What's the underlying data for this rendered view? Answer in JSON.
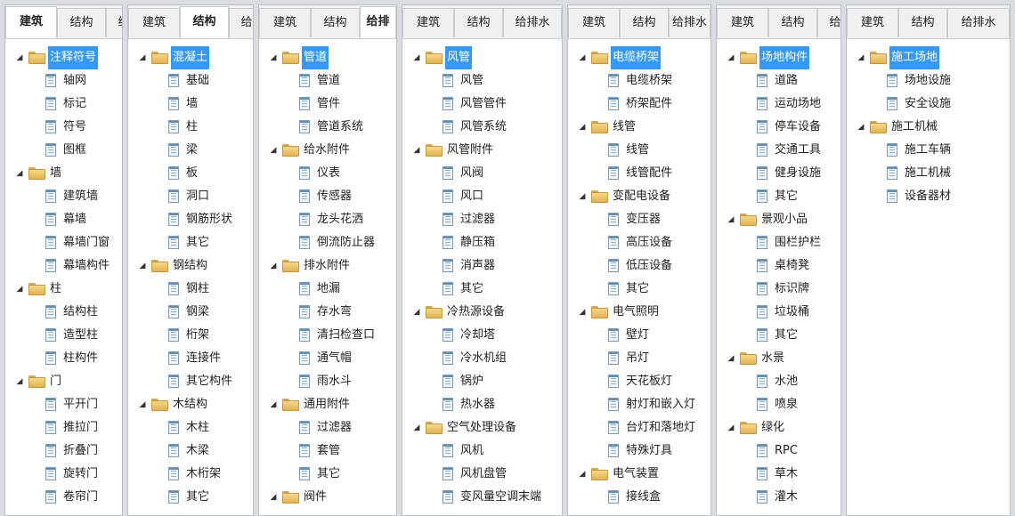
{
  "colors": {
    "selection": "#3399ff",
    "folder": "#e8b95a",
    "background": "#d9dde2"
  },
  "panels": [
    {
      "tabs": [
        "建筑",
        "结构",
        "给"
      ],
      "active_tab": 0,
      "rows": [
        {
          "level": 0,
          "type": "folder",
          "label": "注释符号",
          "selected": true
        },
        {
          "level": 1,
          "type": "doc",
          "label": "轴网"
        },
        {
          "level": 1,
          "type": "doc",
          "label": "标记"
        },
        {
          "level": 1,
          "type": "doc",
          "label": "符号"
        },
        {
          "level": 1,
          "type": "doc",
          "label": "图框"
        },
        {
          "level": 0,
          "type": "folder",
          "label": "墙"
        },
        {
          "level": 1,
          "type": "doc",
          "label": "建筑墙"
        },
        {
          "level": 1,
          "type": "doc",
          "label": "幕墙"
        },
        {
          "level": 1,
          "type": "doc",
          "label": "幕墙门窗"
        },
        {
          "level": 1,
          "type": "doc",
          "label": "幕墙构件"
        },
        {
          "level": 0,
          "type": "folder",
          "label": "柱"
        },
        {
          "level": 1,
          "type": "doc",
          "label": "结构柱"
        },
        {
          "level": 1,
          "type": "doc",
          "label": "造型柱"
        },
        {
          "level": 1,
          "type": "doc",
          "label": "柱构件"
        },
        {
          "level": 0,
          "type": "folder",
          "label": "门"
        },
        {
          "level": 1,
          "type": "doc",
          "label": "平开门"
        },
        {
          "level": 1,
          "type": "doc",
          "label": "推拉门"
        },
        {
          "level": 1,
          "type": "doc",
          "label": "折叠门"
        },
        {
          "level": 1,
          "type": "doc",
          "label": "旋转门"
        },
        {
          "level": 1,
          "type": "doc",
          "label": "卷帘门"
        }
      ]
    },
    {
      "tabs": [
        "建筑",
        "结构",
        "给"
      ],
      "active_tab": 1,
      "rows": [
        {
          "level": 0,
          "type": "folder",
          "label": "混凝土",
          "selected": true
        },
        {
          "level": 1,
          "type": "doc",
          "label": "基础"
        },
        {
          "level": 1,
          "type": "doc",
          "label": "墙"
        },
        {
          "level": 1,
          "type": "doc",
          "label": "柱"
        },
        {
          "level": 1,
          "type": "doc",
          "label": "梁"
        },
        {
          "level": 1,
          "type": "doc",
          "label": "板"
        },
        {
          "level": 1,
          "type": "doc",
          "label": "洞口"
        },
        {
          "level": 1,
          "type": "doc",
          "label": "钢筋形状"
        },
        {
          "level": 1,
          "type": "doc",
          "label": "其它"
        },
        {
          "level": 0,
          "type": "folder",
          "label": "钢结构"
        },
        {
          "level": 1,
          "type": "doc",
          "label": "钢柱"
        },
        {
          "level": 1,
          "type": "doc",
          "label": "钢梁"
        },
        {
          "level": 1,
          "type": "doc",
          "label": "桁架"
        },
        {
          "level": 1,
          "type": "doc",
          "label": "连接件"
        },
        {
          "level": 1,
          "type": "doc",
          "label": "其它构件"
        },
        {
          "level": 0,
          "type": "folder",
          "label": "木结构"
        },
        {
          "level": 1,
          "type": "doc",
          "label": "木柱"
        },
        {
          "level": 1,
          "type": "doc",
          "label": "木梁"
        },
        {
          "level": 1,
          "type": "doc",
          "label": "木桁架"
        },
        {
          "level": 1,
          "type": "doc",
          "label": "其它"
        }
      ]
    },
    {
      "tabs": [
        "建筑",
        "结构",
        "给排"
      ],
      "active_tab": 2,
      "rows": [
        {
          "level": 0,
          "type": "folder",
          "label": "管道",
          "selected": true
        },
        {
          "level": 1,
          "type": "doc",
          "label": "管道"
        },
        {
          "level": 1,
          "type": "doc",
          "label": "管件"
        },
        {
          "level": 1,
          "type": "doc",
          "label": "管道系统"
        },
        {
          "level": 0,
          "type": "folder",
          "label": "给水附件"
        },
        {
          "level": 1,
          "type": "doc",
          "label": "仪表"
        },
        {
          "level": 1,
          "type": "doc",
          "label": "传感器"
        },
        {
          "level": 1,
          "type": "doc",
          "label": "龙头花洒"
        },
        {
          "level": 1,
          "type": "doc",
          "label": "倒流防止器"
        },
        {
          "level": 0,
          "type": "folder",
          "label": "排水附件"
        },
        {
          "level": 1,
          "type": "doc",
          "label": "地漏"
        },
        {
          "level": 1,
          "type": "doc",
          "label": "存水弯"
        },
        {
          "level": 1,
          "type": "doc",
          "label": "清扫检查口"
        },
        {
          "level": 1,
          "type": "doc",
          "label": "通气帽"
        },
        {
          "level": 1,
          "type": "doc",
          "label": "雨水斗"
        },
        {
          "level": 0,
          "type": "folder",
          "label": "通用附件"
        },
        {
          "level": 1,
          "type": "doc",
          "label": "过滤器"
        },
        {
          "level": 1,
          "type": "doc",
          "label": "套管"
        },
        {
          "level": 1,
          "type": "doc",
          "label": "其它"
        },
        {
          "level": 0,
          "type": "folder",
          "label": "阀件"
        }
      ]
    },
    {
      "tabs": [
        "建筑",
        "结构",
        "给排水"
      ],
      "active_tab": -1,
      "rows": [
        {
          "level": 0,
          "type": "folder",
          "label": "风管",
          "selected": true
        },
        {
          "level": 1,
          "type": "doc",
          "label": "风管"
        },
        {
          "level": 1,
          "type": "doc",
          "label": "风管管件"
        },
        {
          "level": 1,
          "type": "doc",
          "label": "风管系统"
        },
        {
          "level": 0,
          "type": "folder",
          "label": "风管附件"
        },
        {
          "level": 1,
          "type": "doc",
          "label": "风阀"
        },
        {
          "level": 1,
          "type": "doc",
          "label": "风口"
        },
        {
          "level": 1,
          "type": "doc",
          "label": "过滤器"
        },
        {
          "level": 1,
          "type": "doc",
          "label": "静压箱"
        },
        {
          "level": 1,
          "type": "doc",
          "label": "消声器"
        },
        {
          "level": 1,
          "type": "doc",
          "label": "其它"
        },
        {
          "level": 0,
          "type": "folder",
          "label": "冷热源设备"
        },
        {
          "level": 1,
          "type": "doc",
          "label": "冷却塔"
        },
        {
          "level": 1,
          "type": "doc",
          "label": "冷水机组"
        },
        {
          "level": 1,
          "type": "doc",
          "label": "锅炉"
        },
        {
          "level": 1,
          "type": "doc",
          "label": "热水器"
        },
        {
          "level": 0,
          "type": "folder",
          "label": "空气处理设备"
        },
        {
          "level": 1,
          "type": "doc",
          "label": "风机"
        },
        {
          "level": 1,
          "type": "doc",
          "label": "风机盘管"
        },
        {
          "level": 1,
          "type": "doc",
          "label": "变风量空调末端"
        }
      ]
    },
    {
      "tabs": [
        "建筑",
        "结构",
        "给排水"
      ],
      "active_tab": -1,
      "rows": [
        {
          "level": 0,
          "type": "folder",
          "label": "电缆桥架",
          "selected": true
        },
        {
          "level": 1,
          "type": "doc",
          "label": "电缆桥架"
        },
        {
          "level": 1,
          "type": "doc",
          "label": "桥架配件"
        },
        {
          "level": 0,
          "type": "folder",
          "label": "线管"
        },
        {
          "level": 1,
          "type": "doc",
          "label": "线管"
        },
        {
          "level": 1,
          "type": "doc",
          "label": "线管配件"
        },
        {
          "level": 0,
          "type": "folder",
          "label": "变配电设备"
        },
        {
          "level": 1,
          "type": "doc",
          "label": "变压器"
        },
        {
          "level": 1,
          "type": "doc",
          "label": "高压设备"
        },
        {
          "level": 1,
          "type": "doc",
          "label": "低压设备"
        },
        {
          "level": 1,
          "type": "doc",
          "label": "其它"
        },
        {
          "level": 0,
          "type": "folder",
          "label": "电气照明"
        },
        {
          "level": 1,
          "type": "doc",
          "label": "壁灯"
        },
        {
          "level": 1,
          "type": "doc",
          "label": "吊灯"
        },
        {
          "level": 1,
          "type": "doc",
          "label": "天花板灯"
        },
        {
          "level": 1,
          "type": "doc",
          "label": "射灯和嵌入灯"
        },
        {
          "level": 1,
          "type": "doc",
          "label": "台灯和落地灯"
        },
        {
          "level": 1,
          "type": "doc",
          "label": "特殊灯具"
        },
        {
          "level": 0,
          "type": "folder",
          "label": "电气装置"
        },
        {
          "level": 1,
          "type": "doc",
          "label": "接线盒"
        }
      ]
    },
    {
      "tabs": [
        "建筑",
        "结构",
        "给"
      ],
      "active_tab": -1,
      "rows": [
        {
          "level": 0,
          "type": "folder",
          "label": "场地构件",
          "selected": true
        },
        {
          "level": 1,
          "type": "doc",
          "label": "道路"
        },
        {
          "level": 1,
          "type": "doc",
          "label": "运动场地"
        },
        {
          "level": 1,
          "type": "doc",
          "label": "停车设备"
        },
        {
          "level": 1,
          "type": "doc",
          "label": "交通工具"
        },
        {
          "level": 1,
          "type": "doc",
          "label": "健身设施"
        },
        {
          "level": 1,
          "type": "doc",
          "label": "其它"
        },
        {
          "level": 0,
          "type": "folder",
          "label": "景观小品"
        },
        {
          "level": 1,
          "type": "doc",
          "label": "围栏护栏"
        },
        {
          "level": 1,
          "type": "doc",
          "label": "桌椅凳"
        },
        {
          "level": 1,
          "type": "doc",
          "label": "标识牌"
        },
        {
          "level": 1,
          "type": "doc",
          "label": "垃圾桶"
        },
        {
          "level": 1,
          "type": "doc",
          "label": "其它"
        },
        {
          "level": 0,
          "type": "folder",
          "label": "水景"
        },
        {
          "level": 1,
          "type": "doc",
          "label": "水池"
        },
        {
          "level": 1,
          "type": "doc",
          "label": "喷泉"
        },
        {
          "level": 0,
          "type": "folder",
          "label": "绿化"
        },
        {
          "level": 1,
          "type": "doc",
          "label": "RPC"
        },
        {
          "level": 1,
          "type": "doc",
          "label": "草木"
        },
        {
          "level": 1,
          "type": "doc",
          "label": "灌木"
        }
      ]
    },
    {
      "tabs": [
        "建筑",
        "结构",
        "给排水"
      ],
      "active_tab": -1,
      "rows": [
        {
          "level": 0,
          "type": "folder",
          "label": "施工场地",
          "selected": true
        },
        {
          "level": 1,
          "type": "doc",
          "label": "场地设施"
        },
        {
          "level": 1,
          "type": "doc",
          "label": "安全设施"
        },
        {
          "level": 0,
          "type": "folder",
          "label": "施工机械"
        },
        {
          "level": 1,
          "type": "doc",
          "label": "施工车辆"
        },
        {
          "level": 1,
          "type": "doc",
          "label": "施工机械"
        },
        {
          "level": 1,
          "type": "doc",
          "label": "设备器材"
        }
      ]
    }
  ]
}
